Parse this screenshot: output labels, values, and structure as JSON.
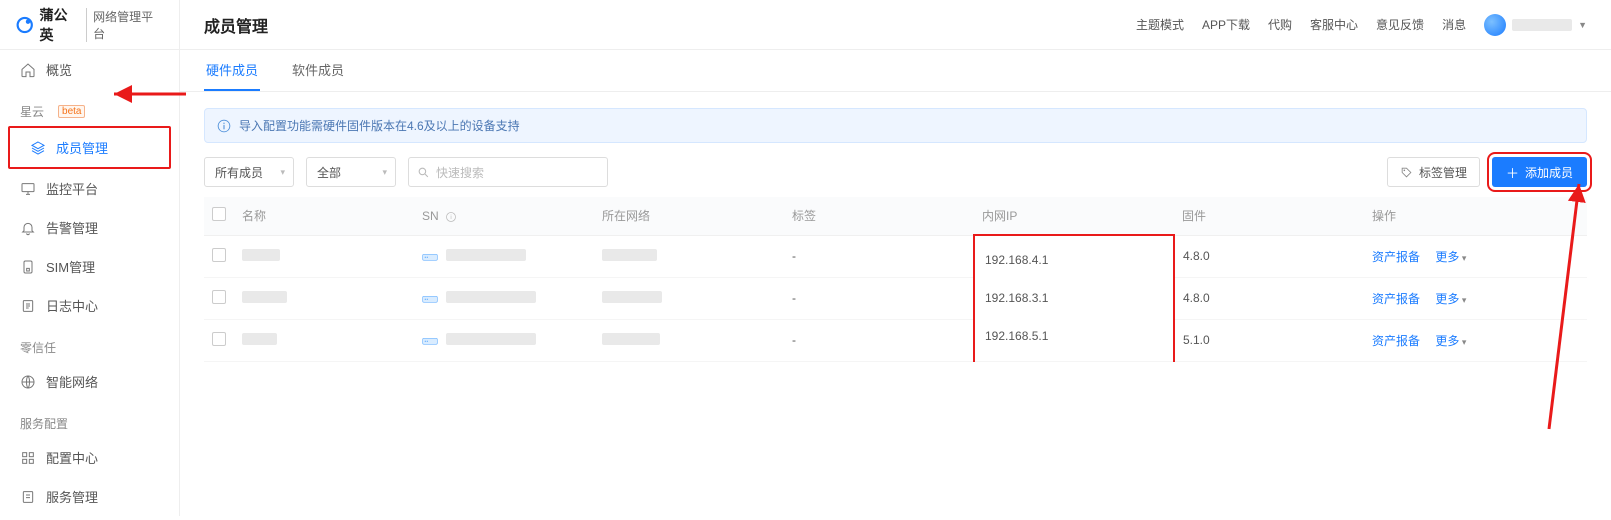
{
  "brand": {
    "name": "蒲公英",
    "sub": "网络管理平台"
  },
  "header": {
    "title": "成员管理",
    "links": [
      "主题模式",
      "APP下载",
      "代购",
      "客服中心",
      "意见反馈",
      "消息"
    ]
  },
  "sidebar": {
    "overview": "概览",
    "group1": {
      "title": "星云",
      "beta": "beta",
      "items": [
        "成员管理",
        "监控平台",
        "告警管理",
        "SIM管理",
        "日志中心"
      ]
    },
    "group2": {
      "title": "零信任",
      "items": [
        "智能网络"
      ]
    },
    "group3": {
      "title": "服务配置",
      "items": [
        "配置中心",
        "服务管理"
      ]
    }
  },
  "tabs": {
    "t0": "硬件成员",
    "t1": "软件成员"
  },
  "banner": "导入配置功能需硬件固件版本在4.6及以上的设备支持",
  "toolbar": {
    "sel_members": "所有成员",
    "sel_all": "全部",
    "search_placeholder": "快速搜索",
    "tag_mgmt": "标签管理",
    "add_member": "添加成员"
  },
  "table": {
    "cols": {
      "name": "名称",
      "sn": "SN",
      "net": "所在网络",
      "tag": "标签",
      "ip": "内网IP",
      "fw": "固件",
      "op": "操作"
    },
    "rows": [
      {
        "tag": "-",
        "ip": "192.168.4.1",
        "fw": "4.8.0",
        "op1": "资产报备",
        "op2": "更多"
      },
      {
        "tag": "-",
        "ip": "192.168.3.1",
        "fw": "4.8.0",
        "op1": "资产报备",
        "op2": "更多"
      },
      {
        "tag": "-",
        "ip": "192.168.5.1",
        "fw": "5.1.0",
        "op1": "资产报备",
        "op2": "更多"
      }
    ]
  }
}
